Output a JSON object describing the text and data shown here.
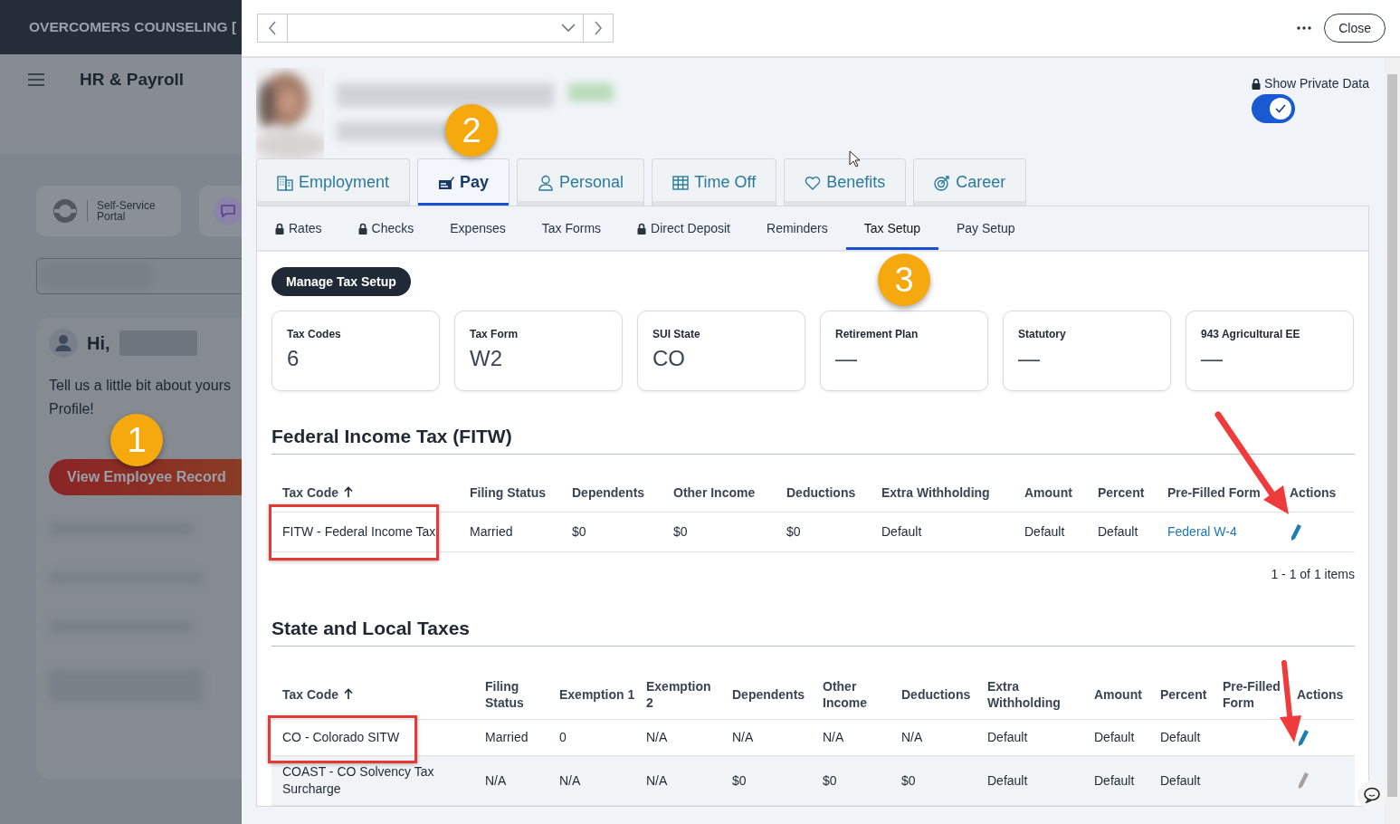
{
  "background_app": {
    "org_title": "OVERCOMERS COUNSELING [",
    "app_title": "HR & Payroll",
    "portal_label": "Self-Service\nPortal",
    "greeting": "Hi,",
    "intro": "Tell us a little bit about yours\nProfile!",
    "record_button": "View Employee Record"
  },
  "drawer": {
    "close_button": "Close",
    "private_toggle": {
      "label": "Show Private Data",
      "on": true
    },
    "tabs": [
      {
        "label": "Employment",
        "kind": "building",
        "selected": false
      },
      {
        "label": "Pay",
        "kind": "check",
        "selected": true
      },
      {
        "label": "Personal",
        "kind": "person",
        "selected": false
      },
      {
        "label": "Time Off",
        "kind": "calendar",
        "selected": false
      },
      {
        "label": "Benefits",
        "kind": "heart",
        "selected": false
      },
      {
        "label": "Career",
        "kind": "target",
        "selected": false
      }
    ],
    "subtabs": [
      {
        "label": "Rates",
        "locked": true,
        "selected": false
      },
      {
        "label": "Checks",
        "locked": true,
        "selected": false
      },
      {
        "label": "Expenses",
        "locked": false,
        "selected": false
      },
      {
        "label": "Tax Forms",
        "locked": false,
        "selected": false
      },
      {
        "label": "Direct Deposit",
        "locked": true,
        "selected": false
      },
      {
        "label": "Reminders",
        "locked": false,
        "selected": false
      },
      {
        "label": "Tax Setup",
        "locked": false,
        "selected": true
      },
      {
        "label": "Pay Setup",
        "locked": false,
        "selected": false
      }
    ],
    "manage_button": "Manage Tax Setup",
    "summary_cards": [
      {
        "label": "Tax Codes",
        "value": "6"
      },
      {
        "label": "Tax Form",
        "value": "W2"
      },
      {
        "label": "SUI State",
        "value": "CO"
      },
      {
        "label": "Retirement Plan",
        "value": "—"
      },
      {
        "label": "Statutory",
        "value": "—"
      },
      {
        "label": "943 Agricultural EE",
        "value": "—"
      }
    ],
    "federal": {
      "title": "Federal Income Tax (FITW)",
      "columns": [
        {
          "label": "Tax Code",
          "sorted": true
        },
        {
          "label": "Filing Status",
          "sorted": false
        },
        {
          "label": "Dependents",
          "sorted": false
        },
        {
          "label": "Other Income",
          "sorted": false
        },
        {
          "label": "Deductions",
          "sorted": false
        },
        {
          "label": "Extra Withholding",
          "sorted": false
        },
        {
          "label": "Amount",
          "sorted": false
        },
        {
          "label": "Percent",
          "sorted": false
        },
        {
          "label": "Pre-Filled Form",
          "sorted": false
        },
        {
          "label": "Actions",
          "sorted": false
        }
      ],
      "rows": [
        {
          "cells": [
            "FITW - Federal Income Tax",
            "Married",
            "$0",
            "$0",
            "$0",
            "Default",
            "Default",
            "Default"
          ],
          "form_link": "Federal W-4",
          "edit_disabled": false
        }
      ],
      "pager": "1 - 1 of 1 items"
    },
    "state": {
      "title": "State and Local Taxes",
      "columns": [
        {
          "label": "Tax Code",
          "sorted": true
        },
        {
          "label": "Filing Status",
          "sorted": false
        },
        {
          "label": "Exemption 1",
          "sorted": false
        },
        {
          "label": "Exemption 2",
          "sorted": false
        },
        {
          "label": "Dependents",
          "sorted": false
        },
        {
          "label": "Other Income",
          "sorted": false
        },
        {
          "label": "Deductions",
          "sorted": false
        },
        {
          "label": "Extra Withholding",
          "sorted": false
        },
        {
          "label": "Amount",
          "sorted": false
        },
        {
          "label": "Percent",
          "sorted": false
        },
        {
          "label": "Pre-Filled Form",
          "sorted": false
        },
        {
          "label": "Actions",
          "sorted": false
        }
      ],
      "rows": [
        {
          "cells": [
            "CO - Colorado SITW",
            "Married",
            "0",
            "N/A",
            "N/A",
            "N/A",
            "N/A",
            "Default",
            "Default",
            "Default"
          ],
          "edit_disabled": false
        },
        {
          "cells": [
            "COAST - CO Solvency Tax Surcharge",
            "N/A",
            "N/A",
            "N/A",
            "$0",
            "$0",
            "$0",
            "Default",
            "Default",
            "Default"
          ],
          "edit_disabled": true
        }
      ]
    }
  },
  "annotations": {
    "badges": [
      {
        "label": "1"
      },
      {
        "label": "2"
      },
      {
        "label": "3"
      }
    ]
  }
}
